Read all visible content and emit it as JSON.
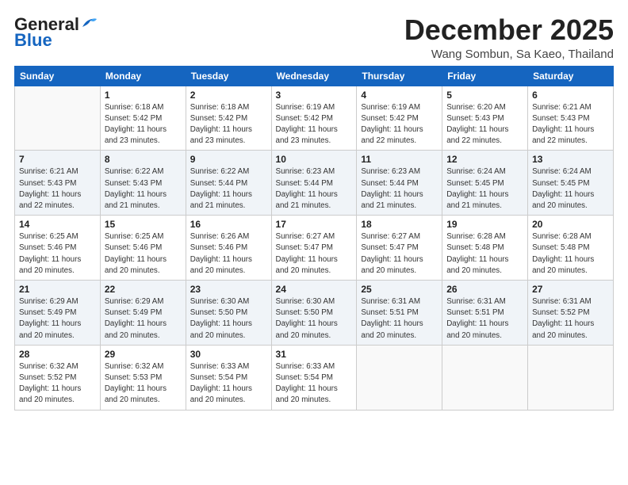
{
  "header": {
    "logo_general": "General",
    "logo_blue": "Blue",
    "month": "December 2025",
    "location": "Wang Sombun, Sa Kaeo, Thailand"
  },
  "days_of_week": [
    "Sunday",
    "Monday",
    "Tuesday",
    "Wednesday",
    "Thursday",
    "Friday",
    "Saturday"
  ],
  "weeks": [
    [
      {
        "day": "",
        "empty": true
      },
      {
        "day": "1",
        "sunrise": "6:18 AM",
        "sunset": "5:42 PM",
        "daylight": "11 hours and 23 minutes."
      },
      {
        "day": "2",
        "sunrise": "6:18 AM",
        "sunset": "5:42 PM",
        "daylight": "11 hours and 23 minutes."
      },
      {
        "day": "3",
        "sunrise": "6:19 AM",
        "sunset": "5:42 PM",
        "daylight": "11 hours and 23 minutes."
      },
      {
        "day": "4",
        "sunrise": "6:19 AM",
        "sunset": "5:42 PM",
        "daylight": "11 hours and 22 minutes."
      },
      {
        "day": "5",
        "sunrise": "6:20 AM",
        "sunset": "5:43 PM",
        "daylight": "11 hours and 22 minutes."
      },
      {
        "day": "6",
        "sunrise": "6:21 AM",
        "sunset": "5:43 PM",
        "daylight": "11 hours and 22 minutes."
      }
    ],
    [
      {
        "day": "7",
        "sunrise": "6:21 AM",
        "sunset": "5:43 PM",
        "daylight": "11 hours and 22 minutes."
      },
      {
        "day": "8",
        "sunrise": "6:22 AM",
        "sunset": "5:43 PM",
        "daylight": "11 hours and 21 minutes."
      },
      {
        "day": "9",
        "sunrise": "6:22 AM",
        "sunset": "5:44 PM",
        "daylight": "11 hours and 21 minutes."
      },
      {
        "day": "10",
        "sunrise": "6:23 AM",
        "sunset": "5:44 PM",
        "daylight": "11 hours and 21 minutes."
      },
      {
        "day": "11",
        "sunrise": "6:23 AM",
        "sunset": "5:44 PM",
        "daylight": "11 hours and 21 minutes."
      },
      {
        "day": "12",
        "sunrise": "6:24 AM",
        "sunset": "5:45 PM",
        "daylight": "11 hours and 21 minutes."
      },
      {
        "day": "13",
        "sunrise": "6:24 AM",
        "sunset": "5:45 PM",
        "daylight": "11 hours and 20 minutes."
      }
    ],
    [
      {
        "day": "14",
        "sunrise": "6:25 AM",
        "sunset": "5:46 PM",
        "daylight": "11 hours and 20 minutes."
      },
      {
        "day": "15",
        "sunrise": "6:25 AM",
        "sunset": "5:46 PM",
        "daylight": "11 hours and 20 minutes."
      },
      {
        "day": "16",
        "sunrise": "6:26 AM",
        "sunset": "5:46 PM",
        "daylight": "11 hours and 20 minutes."
      },
      {
        "day": "17",
        "sunrise": "6:27 AM",
        "sunset": "5:47 PM",
        "daylight": "11 hours and 20 minutes."
      },
      {
        "day": "18",
        "sunrise": "6:27 AM",
        "sunset": "5:47 PM",
        "daylight": "11 hours and 20 minutes."
      },
      {
        "day": "19",
        "sunrise": "6:28 AM",
        "sunset": "5:48 PM",
        "daylight": "11 hours and 20 minutes."
      },
      {
        "day": "20",
        "sunrise": "6:28 AM",
        "sunset": "5:48 PM",
        "daylight": "11 hours and 20 minutes."
      }
    ],
    [
      {
        "day": "21",
        "sunrise": "6:29 AM",
        "sunset": "5:49 PM",
        "daylight": "11 hours and 20 minutes."
      },
      {
        "day": "22",
        "sunrise": "6:29 AM",
        "sunset": "5:49 PM",
        "daylight": "11 hours and 20 minutes."
      },
      {
        "day": "23",
        "sunrise": "6:30 AM",
        "sunset": "5:50 PM",
        "daylight": "11 hours and 20 minutes."
      },
      {
        "day": "24",
        "sunrise": "6:30 AM",
        "sunset": "5:50 PM",
        "daylight": "11 hours and 20 minutes."
      },
      {
        "day": "25",
        "sunrise": "6:31 AM",
        "sunset": "5:51 PM",
        "daylight": "11 hours and 20 minutes."
      },
      {
        "day": "26",
        "sunrise": "6:31 AM",
        "sunset": "5:51 PM",
        "daylight": "11 hours and 20 minutes."
      },
      {
        "day": "27",
        "sunrise": "6:31 AM",
        "sunset": "5:52 PM",
        "daylight": "11 hours and 20 minutes."
      }
    ],
    [
      {
        "day": "28",
        "sunrise": "6:32 AM",
        "sunset": "5:52 PM",
        "daylight": "11 hours and 20 minutes."
      },
      {
        "day": "29",
        "sunrise": "6:32 AM",
        "sunset": "5:53 PM",
        "daylight": "11 hours and 20 minutes."
      },
      {
        "day": "30",
        "sunrise": "6:33 AM",
        "sunset": "5:54 PM",
        "daylight": "11 hours and 20 minutes."
      },
      {
        "day": "31",
        "sunrise": "6:33 AM",
        "sunset": "5:54 PM",
        "daylight": "11 hours and 20 minutes."
      },
      {
        "day": "",
        "empty": true
      },
      {
        "day": "",
        "empty": true
      },
      {
        "day": "",
        "empty": true
      }
    ]
  ]
}
